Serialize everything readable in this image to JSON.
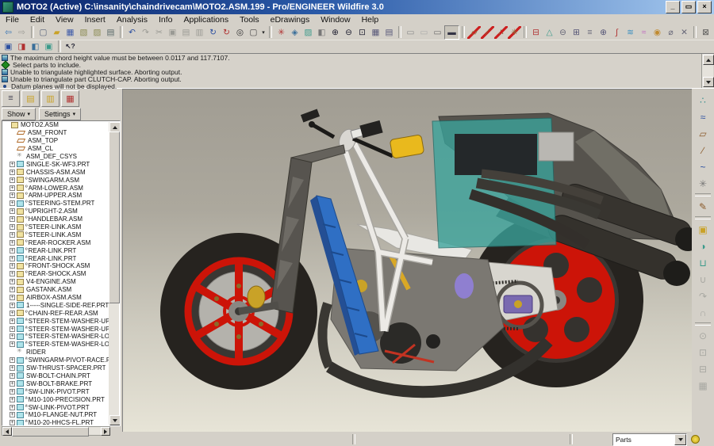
{
  "window": {
    "title": "MOTO2 (Active) C:\\insanity\\chaindrivecam\\MOTO2.ASM.199 - Pro/ENGINEER Wildfire 3.0",
    "buttons": [
      {
        "n": "minimize-button",
        "g": "_"
      },
      {
        "n": "restore-button",
        "g": "▭"
      },
      {
        "n": "close-button",
        "g": "×"
      }
    ]
  },
  "menu": [
    "File",
    "Edit",
    "View",
    "Insert",
    "Analysis",
    "Info",
    "Applications",
    "Tools",
    "eDrawings",
    "Window",
    "Help"
  ],
  "toolbar_main": [
    {
      "n": "web-back-icon",
      "g": "⇦",
      "s": "color:#2f6fb4"
    },
    {
      "n": "web-forward-icon",
      "g": "⇨",
      "s": "color:#9a9a94"
    },
    {
      "n": "separator",
      "g": "",
      "cls": "sepbar"
    },
    {
      "n": "new-file-icon",
      "g": "▢",
      "s": "color:#55617a"
    },
    {
      "n": "open-file-icon",
      "g": "▰",
      "s": "color:#c9a227"
    },
    {
      "n": "save-icon",
      "g": "▦",
      "s": "color:#3a57a8"
    },
    {
      "n": "save-copy-icon",
      "g": "▧",
      "s": "color:#8a8a50"
    },
    {
      "n": "backup-icon",
      "g": "▨",
      "s": "color:#8a8a50"
    },
    {
      "n": "print-icon",
      "g": "▤",
      "s": "color:#566"
    },
    {
      "n": "separator",
      "g": "",
      "cls": "sepbar"
    },
    {
      "n": "undo-icon",
      "g": "↶",
      "s": "color:#2b4fa0"
    },
    {
      "n": "redo-icon",
      "g": "↷",
      "s": "color:#9a9a94"
    },
    {
      "n": "cut-icon",
      "g": "✂",
      "s": "color:#9a9a94"
    },
    {
      "n": "copy-icon",
      "g": "▣",
      "s": "color:#9a9a94"
    },
    {
      "n": "paste-icon",
      "g": "▤",
      "s": "color:#9a9a94"
    },
    {
      "n": "paste-special-icon",
      "g": "▥",
      "s": "color:#9a9a94"
    },
    {
      "n": "regenerate-icon",
      "g": "↻",
      "s": "color:#2b4fa0"
    },
    {
      "n": "regen-manager-icon",
      "g": "↻",
      "s": "color:#b03030"
    },
    {
      "n": "find-icon",
      "g": "◎",
      "s": "color:#333"
    },
    {
      "n": "select-rect-icon",
      "g": "▢",
      "s": "color:#444"
    },
    {
      "n": "select-options-caret",
      "g": "▾",
      "s": "color:#222",
      "cls": "car"
    },
    {
      "n": "separator",
      "g": "",
      "cls": "sepbar"
    },
    {
      "n": "spin-center-icon",
      "g": "✳",
      "s": "color:#b03030"
    },
    {
      "n": "reorient-view-icon",
      "g": "◈",
      "s": "color:#3a6f9a"
    },
    {
      "n": "repaint-icon",
      "g": "▨",
      "s": "color:#3a9a8a"
    },
    {
      "n": "shade-icon",
      "g": "◧",
      "s": "color:#777"
    },
    {
      "n": "zoom-in-icon",
      "g": "⊕",
      "s": "color:#223"
    },
    {
      "n": "zoom-out-icon",
      "g": "⊖",
      "s": "color:#223"
    },
    {
      "n": "refit-icon",
      "g": "⊡",
      "s": "color:#223"
    },
    {
      "n": "saved-views-icon",
      "g": "▦",
      "s": "color:#557"
    },
    {
      "n": "view-manager-icon",
      "g": "▤",
      "s": "color:#557"
    },
    {
      "n": "separator",
      "g": "",
      "cls": "sepbar"
    },
    {
      "n": "wireframe-display-icon",
      "g": "▭",
      "s": "color:#888"
    },
    {
      "n": "hidden-line-display-icon",
      "g": "▭",
      "s": "color:#aaa"
    },
    {
      "n": "no-hidden-display-icon",
      "g": "▭",
      "s": "color:#666"
    },
    {
      "n": "shaded-display-icon",
      "g": "▬",
      "s": "color:#334",
      "cls": "pressed"
    },
    {
      "n": "separator",
      "g": "",
      "cls": "sepbar"
    },
    {
      "n": "datum-plane-toggle-icon",
      "g": "▱",
      "s": "color:#8a6a3a",
      "cls": "slash"
    },
    {
      "n": "datum-axis-toggle-icon",
      "g": "∕",
      "s": "color:#8a6a3a",
      "cls": "slash"
    },
    {
      "n": "datum-point-toggle-icon",
      "g": "∴",
      "s": "color:#8a6a3a",
      "cls": "slash"
    },
    {
      "n": "csys-toggle-icon",
      "g": "✳",
      "s": "color:#8a6a3a",
      "cls": "slash"
    },
    {
      "n": "separator",
      "g": "",
      "cls": "sepbar"
    },
    {
      "n": "annotation-display-icon",
      "g": "⊟",
      "s": "color:#b03030"
    },
    {
      "n": "perspective-display-icon",
      "g": "△",
      "s": "color:#3a9a8a"
    },
    {
      "n": "section-display-icon",
      "g": "⊖",
      "s": "color:#667"
    },
    {
      "n": "grid-display-icon",
      "g": "⊞",
      "s": "color:#557"
    },
    {
      "n": "layer-display-icon",
      "g": "≡",
      "s": "color:#667"
    },
    {
      "n": "enhanced-realism-icon",
      "g": "⊕",
      "s": "color:#557"
    },
    {
      "n": "spline-display-icon",
      "g": "∫",
      "s": "color:#b03030"
    },
    {
      "n": "surface-analysis-icon",
      "g": "≋",
      "s": "color:#3a8fc0"
    },
    {
      "n": "mesh-display-icon",
      "g": "≈",
      "s": "color:#c06ac0"
    },
    {
      "n": "render-display-icon",
      "g": "◉",
      "s": "color:#c08a30"
    },
    {
      "n": "smart-select-off-icon",
      "g": "⌀",
      "s": "color:#667"
    },
    {
      "n": "deselect-icon",
      "g": "✕",
      "s": "color:#667"
    },
    {
      "n": "separator",
      "g": "",
      "cls": "sepbar"
    },
    {
      "n": "window-close-icon",
      "g": "⊠",
      "s": "color:#555"
    },
    {
      "n": "window-activate-icon",
      "g": "⊡",
      "s": "color:#555"
    },
    {
      "n": "window-close-all-icon",
      "g": "⊠",
      "s": "color:#555"
    }
  ],
  "toolbar_assembly": [
    {
      "n": "add-component-icon",
      "g": "▣",
      "s": "color:#2b4fa0"
    },
    {
      "n": "create-component-icon",
      "g": "◨",
      "s": "color:#b03030"
    },
    {
      "n": "component-operations-icon",
      "g": "◧",
      "s": "color:#3a6f9a"
    },
    {
      "n": "include-component-icon",
      "g": "▣",
      "s": "color:#3a9a8a"
    },
    {
      "n": "separator",
      "g": "",
      "cls": "sepbar"
    },
    {
      "n": "context-help-icon",
      "g": "↖?",
      "s": "color:#223;font-weight:bold;font-size:8.5px"
    }
  ],
  "messages": [
    {
      "icon": "error",
      "text": "The maximum chord height value must be between 0.0117 and 117.7107."
    },
    {
      "icon": "prompt",
      "text": "Select parts to include."
    },
    {
      "icon": "error",
      "text": "Unable to triangulate highlighted surface. Aborting output."
    },
    {
      "icon": "error",
      "text": "Unable to triangulate part CLUTCH-CAP.  Aborting output."
    },
    {
      "icon": "info",
      "text": "Datum planes will not be displayed."
    }
  ],
  "tree_panel": {
    "tabs": [
      {
        "n": "model-tree-tab-icon",
        "g": "≡",
        "s": "color:#445"
      },
      {
        "n": "layer-tree-tab-icon",
        "g": "▤",
        "s": "color:#c9a227"
      },
      {
        "n": "folder-browser-tab-icon",
        "g": "▥",
        "s": "color:#c9a227"
      },
      {
        "n": "favorites-tab-icon",
        "g": "▦",
        "s": "color:#b03030"
      }
    ],
    "show_label": "Show",
    "settings_label": "Settings",
    "caret": "▾"
  },
  "model_tree": [
    {
      "label": "MOTO2.ASM",
      "t": "asm",
      "p": 0,
      "st": ""
    },
    {
      "label": "ASM_FRONT",
      "t": "plane",
      "p": 0,
      "st": ""
    },
    {
      "label": "ASM_TOP",
      "t": "plane",
      "p": 0,
      "st": ""
    },
    {
      "label": "ASM_CL",
      "t": "plane",
      "p": 0,
      "st": ""
    },
    {
      "label": "ASM_DEF_CSYS",
      "t": "csys",
      "p": 0,
      "st": ""
    },
    {
      "label": "SINGLE-SK-WF3.PRT",
      "t": "prt",
      "p": 1,
      "st": ""
    },
    {
      "label": "CHASSIS-ASM.ASM",
      "t": "asm",
      "p": 1,
      "st": ""
    },
    {
      "label": "SWINGARM.ASM",
      "t": "asm",
      "p": 1,
      "st": "º"
    },
    {
      "label": "ARM-LOWER.ASM",
      "t": "asm",
      "p": 1,
      "st": "º"
    },
    {
      "label": "ARM-UPPER.ASM",
      "t": "asm",
      "p": 1,
      "st": "º"
    },
    {
      "label": "STEERING-STEM.PRT",
      "t": "prt",
      "p": 1,
      "st": "º"
    },
    {
      "label": "UPRIGHT-2.ASM",
      "t": "asm",
      "p": 1,
      "st": "º"
    },
    {
      "label": "HANDLEBAR.ASM",
      "t": "asm",
      "p": 1,
      "st": "º"
    },
    {
      "label": "STEER-LINK.ASM",
      "t": "asm",
      "p": 1,
      "st": "º"
    },
    {
      "label": "STEER-LINK.ASM",
      "t": "asm",
      "p": 1,
      "st": "º"
    },
    {
      "label": "REAR-ROCKER.ASM",
      "t": "asm",
      "p": 1,
      "st": "º"
    },
    {
      "label": "REAR-LINK.PRT",
      "t": "prt",
      "p": 1,
      "st": "º"
    },
    {
      "label": "REAR-LINK.PRT",
      "t": "prt",
      "p": 1,
      "st": "ª"
    },
    {
      "label": "FRONT-SHOCK.ASM",
      "t": "asm",
      "p": 1,
      "st": "º"
    },
    {
      "label": "REAR-SHOCK.ASM",
      "t": "asm",
      "p": 1,
      "st": "º"
    },
    {
      "label": "V4-ENGINE.ASM",
      "t": "asm",
      "p": 1,
      "st": ""
    },
    {
      "label": "GASTANK.ASM",
      "t": "asm",
      "p": 1,
      "st": ""
    },
    {
      "label": "AIRBOX-ASM.ASM",
      "t": "asm",
      "p": 1,
      "st": ""
    },
    {
      "label": "1-----SINGLE-SIDE-REF.PRT",
      "t": "prt",
      "p": 1,
      "st": ""
    },
    {
      "label": "CHAIN-REF-REAR.ASM",
      "t": "asm",
      "p": 1,
      "st": "º"
    },
    {
      "label": "STEER-STEM-WASHER-UPPEI",
      "t": "prt",
      "p": 1,
      "st": "ª"
    },
    {
      "label": "STEER-STEM-WASHER-UPPEI",
      "t": "prt",
      "p": 1,
      "st": "ª"
    },
    {
      "label": "STEER-STEM-WASHER-LOWE",
      "t": "prt",
      "p": 1,
      "st": "ª"
    },
    {
      "label": "STEER-STEM-WASHER-LOWE",
      "t": "prt",
      "p": 1,
      "st": "ª"
    },
    {
      "label": "RIDER",
      "t": "csys",
      "p": 0,
      "st": ""
    },
    {
      "label": "SWINGARM-PIVOT-RACE.PRT",
      "t": "prt",
      "p": 1,
      "st": "ª"
    },
    {
      "label": "SW-THRUST-SPACER.PRT",
      "t": "prt",
      "p": 1,
      "st": ""
    },
    {
      "label": "SW-BOLT-CHAIN.PRT",
      "t": "prt",
      "p": 1,
      "st": ""
    },
    {
      "label": "SW-BOLT-BRAKE.PRT",
      "t": "prt",
      "p": 1,
      "st": ""
    },
    {
      "label": "SW-LINK-PIVOT.PRT",
      "t": "prt",
      "p": 1,
      "st": "ª"
    },
    {
      "label": "M10-100-PRECISION.PRT",
      "t": "prt",
      "p": 1,
      "st": "ª"
    },
    {
      "label": "SW-LINK-PIVOT.PRT",
      "t": "prt",
      "p": 1,
      "st": "ª"
    },
    {
      "label": "M10-FLANGE-NUT.PRT",
      "t": "prt",
      "p": 1,
      "st": "ª"
    },
    {
      "label": "M10-20-HHCS-FL.PRT",
      "t": "prt",
      "p": 1,
      "st": "ª"
    }
  ],
  "right_toolbar": [
    {
      "n": "datum-point-tool-icon",
      "g": "∴",
      "s": "color:#3a8f8f"
    },
    {
      "n": "sketched-curve-tool-icon",
      "g": "≈",
      "s": "color:#2b4fa0"
    },
    {
      "n": "datum-plane-tool-icon",
      "g": "▱",
      "s": "color:#8a5a2a"
    },
    {
      "n": "datum-axis-tool-icon",
      "g": "∕",
      "s": "color:#8a5a2a"
    },
    {
      "n": "curve-tool-icon",
      "g": "~",
      "s": "color:#2b4fa0"
    },
    {
      "n": "csys-tool-icon",
      "g": "✳",
      "s": "color:#777"
    },
    {
      "n": "separator",
      "g": "",
      "cls": "vsep"
    },
    {
      "n": "sketch-tool-icon",
      "g": "✎",
      "s": "color:#8a5a2a"
    },
    {
      "n": "separator",
      "g": "",
      "cls": "vsep"
    },
    {
      "n": "extrude-tool-icon",
      "g": "▣",
      "s": "color:#c9a227"
    },
    {
      "n": "revolve-tool-icon",
      "g": "◑",
      "s": "color:#3a9a8a"
    },
    {
      "n": "sweep-tool-icon",
      "g": "⊔",
      "s": "color:#3a9a8a"
    },
    {
      "n": "boundary-blend-tool-icon",
      "g": "∪",
      "s": "color:#a8a8a2"
    },
    {
      "n": "style-tool-icon",
      "g": "↷",
      "s": "color:#a8a8a2"
    },
    {
      "n": "datum-curve-tool-icon",
      "g": "∩",
      "s": "color:#a8a8a2"
    },
    {
      "n": "separator",
      "g": "",
      "cls": "vsep"
    },
    {
      "n": "hole-tool-icon",
      "g": "⊙",
      "s": "color:#a8a8a2"
    },
    {
      "n": "shell-tool-icon",
      "g": "⊡",
      "s": "color:#a8a8a2"
    },
    {
      "n": "rib-tool-icon",
      "g": "⊟",
      "s": "color:#a8a8a2"
    },
    {
      "n": "pattern-tool-icon",
      "g": "▦",
      "s": "color:#a8a8a2"
    }
  ],
  "status_bar": {
    "filter_value": "Parts"
  },
  "colors": {
    "titlebar_left": "#0a246a",
    "titlebar_right": "#a6caf0",
    "chrome": "#d4d0c8",
    "tire": "#26231f",
    "rim_red": "#cc1408",
    "frame_white": "#eceae6",
    "swingarm_gray": "#d8d6cf",
    "airbox_teal": "#3aa49c",
    "seat_gray": "#56534d",
    "strut_blue": "#2f6fc4",
    "damper_yellow": "#e9b91d",
    "bg_top": "#a19d93",
    "bg_bottom": "#e7e4d7"
  }
}
